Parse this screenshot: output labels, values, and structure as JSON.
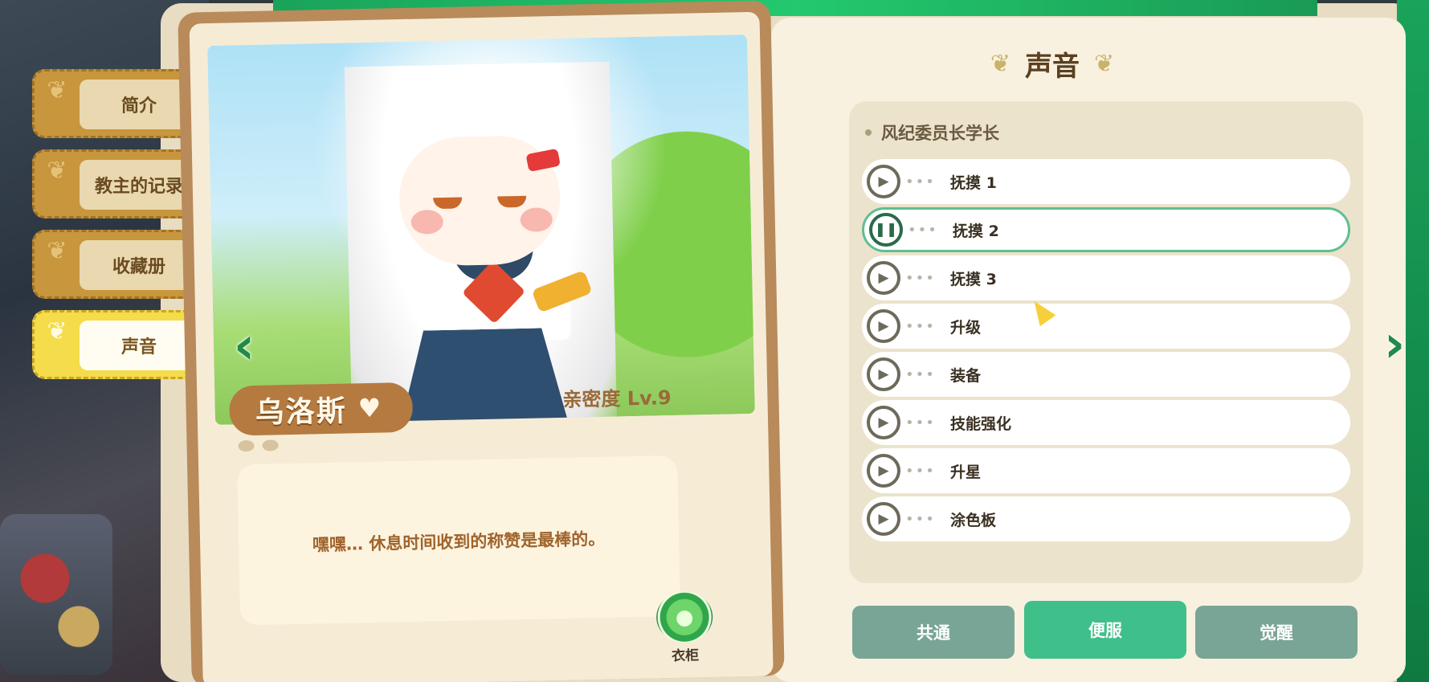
{
  "tabs": [
    {
      "label": "简介",
      "active": false
    },
    {
      "label": "教主的记录",
      "active": false
    },
    {
      "label": "收藏册",
      "active": false
    },
    {
      "label": "声音",
      "active": true
    }
  ],
  "character": {
    "name": "乌洛斯",
    "affinity": "亲密度 Lv.9",
    "quote": "嘿嘿… 休息时间收到的称赞是最棒的。"
  },
  "wardrobe": {
    "label": "衣柜",
    "icon": "wardrobe-icon"
  },
  "voice_panel": {
    "title": "声音",
    "section_header": "风纪委员长学长",
    "items": [
      {
        "label": "抚摸 1",
        "state": "play"
      },
      {
        "label": "抚摸 2",
        "state": "pause"
      },
      {
        "label": "抚摸 3",
        "state": "play"
      },
      {
        "label": "升级",
        "state": "play"
      },
      {
        "label": "装备",
        "state": "play"
      },
      {
        "label": "技能强化",
        "state": "play"
      },
      {
        "label": "升星",
        "state": "play"
      },
      {
        "label": "涂色板",
        "state": "play"
      }
    ],
    "buttons": [
      {
        "label": "共通",
        "active": false
      },
      {
        "label": "便服",
        "active": true
      },
      {
        "label": "觉醒",
        "active": false
      }
    ]
  },
  "colors": {
    "accent": "#3fbf8a",
    "tab_active": "#f4dc4a",
    "tab": "#c8963c",
    "card": "#b98a5a"
  }
}
